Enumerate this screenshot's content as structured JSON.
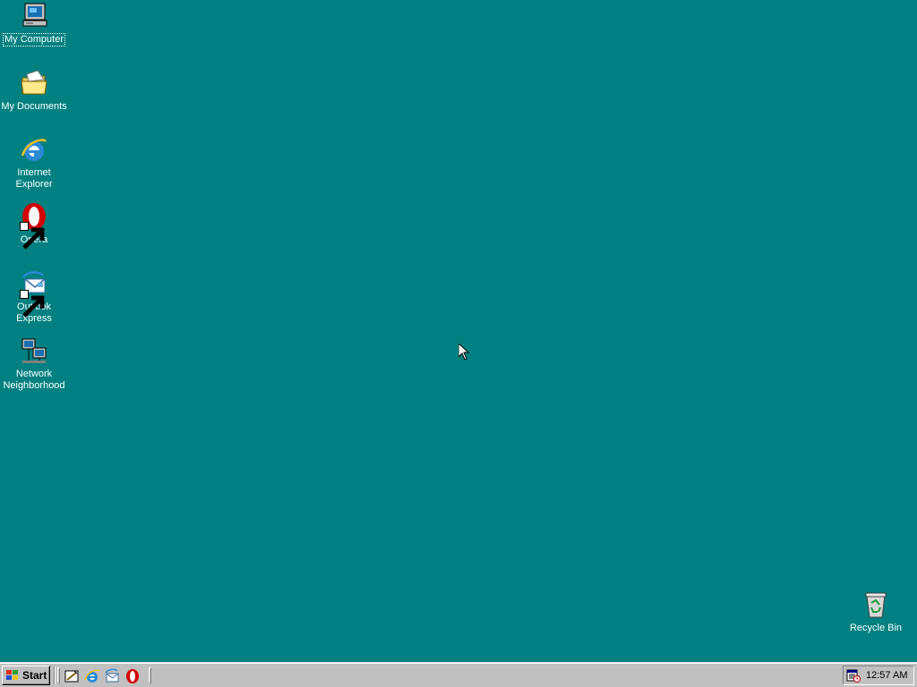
{
  "desktop": {
    "background": "#008080",
    "icons": [
      {
        "label": "My Computer",
        "icon": "computer-icon",
        "selected": true
      },
      {
        "label": "My Documents",
        "icon": "folder-icon"
      },
      {
        "label_line1": "Internet",
        "label_line2": "Explorer",
        "icon": "internet-explorer-icon"
      },
      {
        "label": "Opera",
        "icon": "opera-icon"
      },
      {
        "label_line1": "Outlook",
        "label_line2": "Express",
        "icon": "outlook-express-icon"
      },
      {
        "label_line1": "Network",
        "label_line2": "Neighborhood",
        "icon": "network-icon"
      },
      {
        "label": "Recycle Bin",
        "icon": "recycle-bin-icon"
      }
    ]
  },
  "taskbar": {
    "start_label": "Start",
    "quick_launch": [
      "show-desktop-icon",
      "internet-explorer-icon",
      "outlook-express-icon",
      "opera-icon"
    ],
    "tray_icon": "scheduler-icon",
    "clock": "12:57 AM"
  }
}
